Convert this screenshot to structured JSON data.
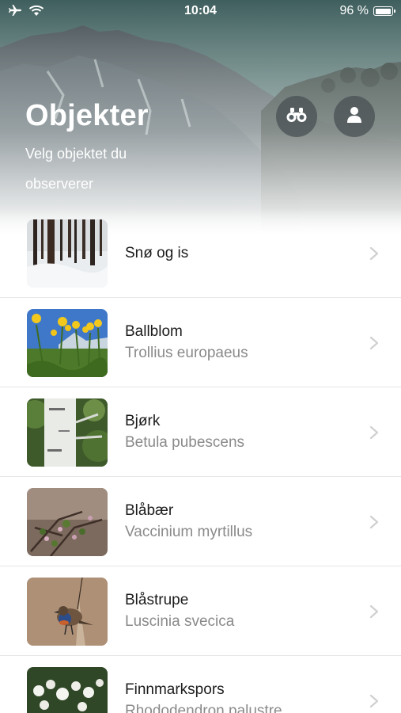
{
  "status_bar": {
    "time": "10:04",
    "battery": "96 %",
    "battery_level": 0.96,
    "icons": [
      "airplane-icon",
      "wifi-icon",
      "battery-icon"
    ]
  },
  "header": {
    "title": "Objekter",
    "subtitle": "Velg objektet du observerer",
    "observe_button_icon": "binoculars-icon",
    "profile_button_icon": "person-icon"
  },
  "colors": {
    "sky": "#4f6f6c",
    "mountain_dark": "#3f4b52",
    "text_primary": "#1c1c1c",
    "text_secondary": "#8a8a8a",
    "button_bg": "#464e52"
  },
  "objects": [
    {
      "name": "Snø og is",
      "latin": ""
    },
    {
      "name": "Ballblom",
      "latin": "Trollius europaeus"
    },
    {
      "name": "Bjørk",
      "latin": "Betula pubescens"
    },
    {
      "name": "Blåbær",
      "latin": "Vaccinium myrtillus"
    },
    {
      "name": "Blåstrupe",
      "latin": "Luscinia svecica"
    },
    {
      "name": "Finnmarkspors",
      "latin": "Rhododendron palustre"
    }
  ]
}
